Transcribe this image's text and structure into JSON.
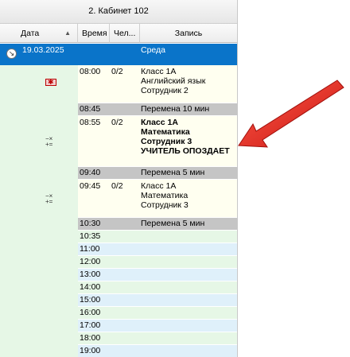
{
  "title": "2. Кабинет 102",
  "columns": {
    "date": "Дата",
    "time": "Время",
    "people": "Чел...",
    "record": "Запись"
  },
  "selected_row": {
    "date": "19.03.2025",
    "day": "Среда"
  },
  "lessons": [
    {
      "time": "08:00",
      "count": "0/2",
      "lines": [
        "Класс 1А",
        "Английский язык",
        "Сотрудник 2"
      ]
    },
    {
      "time": "08:55",
      "count": "0/2",
      "lines": [
        "Класс 1А",
        "Математика",
        "Сотрудник 3",
        "УЧИТЕЛЬ ОПОЗДАЕТ"
      ]
    },
    {
      "time": "09:45",
      "count": "0/2",
      "lines": [
        "Класс 1А",
        "Математика",
        "Сотрудник 3"
      ]
    }
  ],
  "breaks": [
    {
      "time": "08:45",
      "label": "Перемена 10 мин"
    },
    {
      "time": "09:40",
      "label": "Перемена 5 мин"
    },
    {
      "time": "10:30",
      "label": "Перемена 5 мин"
    }
  ],
  "empty_times": [
    "10:35",
    "11:00",
    "12:00",
    "13:00",
    "14:00",
    "15:00",
    "16:00",
    "17:00",
    "18:00",
    "19:00"
  ],
  "icons": {
    "expand": "↘",
    "lesson_1": "flag-icon",
    "lesson_2_ops": [
      "−×",
      "+="
    ],
    "lesson_3_ops": [
      "−×",
      "+="
    ]
  },
  "colors": {
    "selection": "#0a74c9",
    "arrow": "#e2231a",
    "break": "#c5c5c5",
    "lesson": "#fffff0",
    "date_strip": "#e6f7e6"
  }
}
